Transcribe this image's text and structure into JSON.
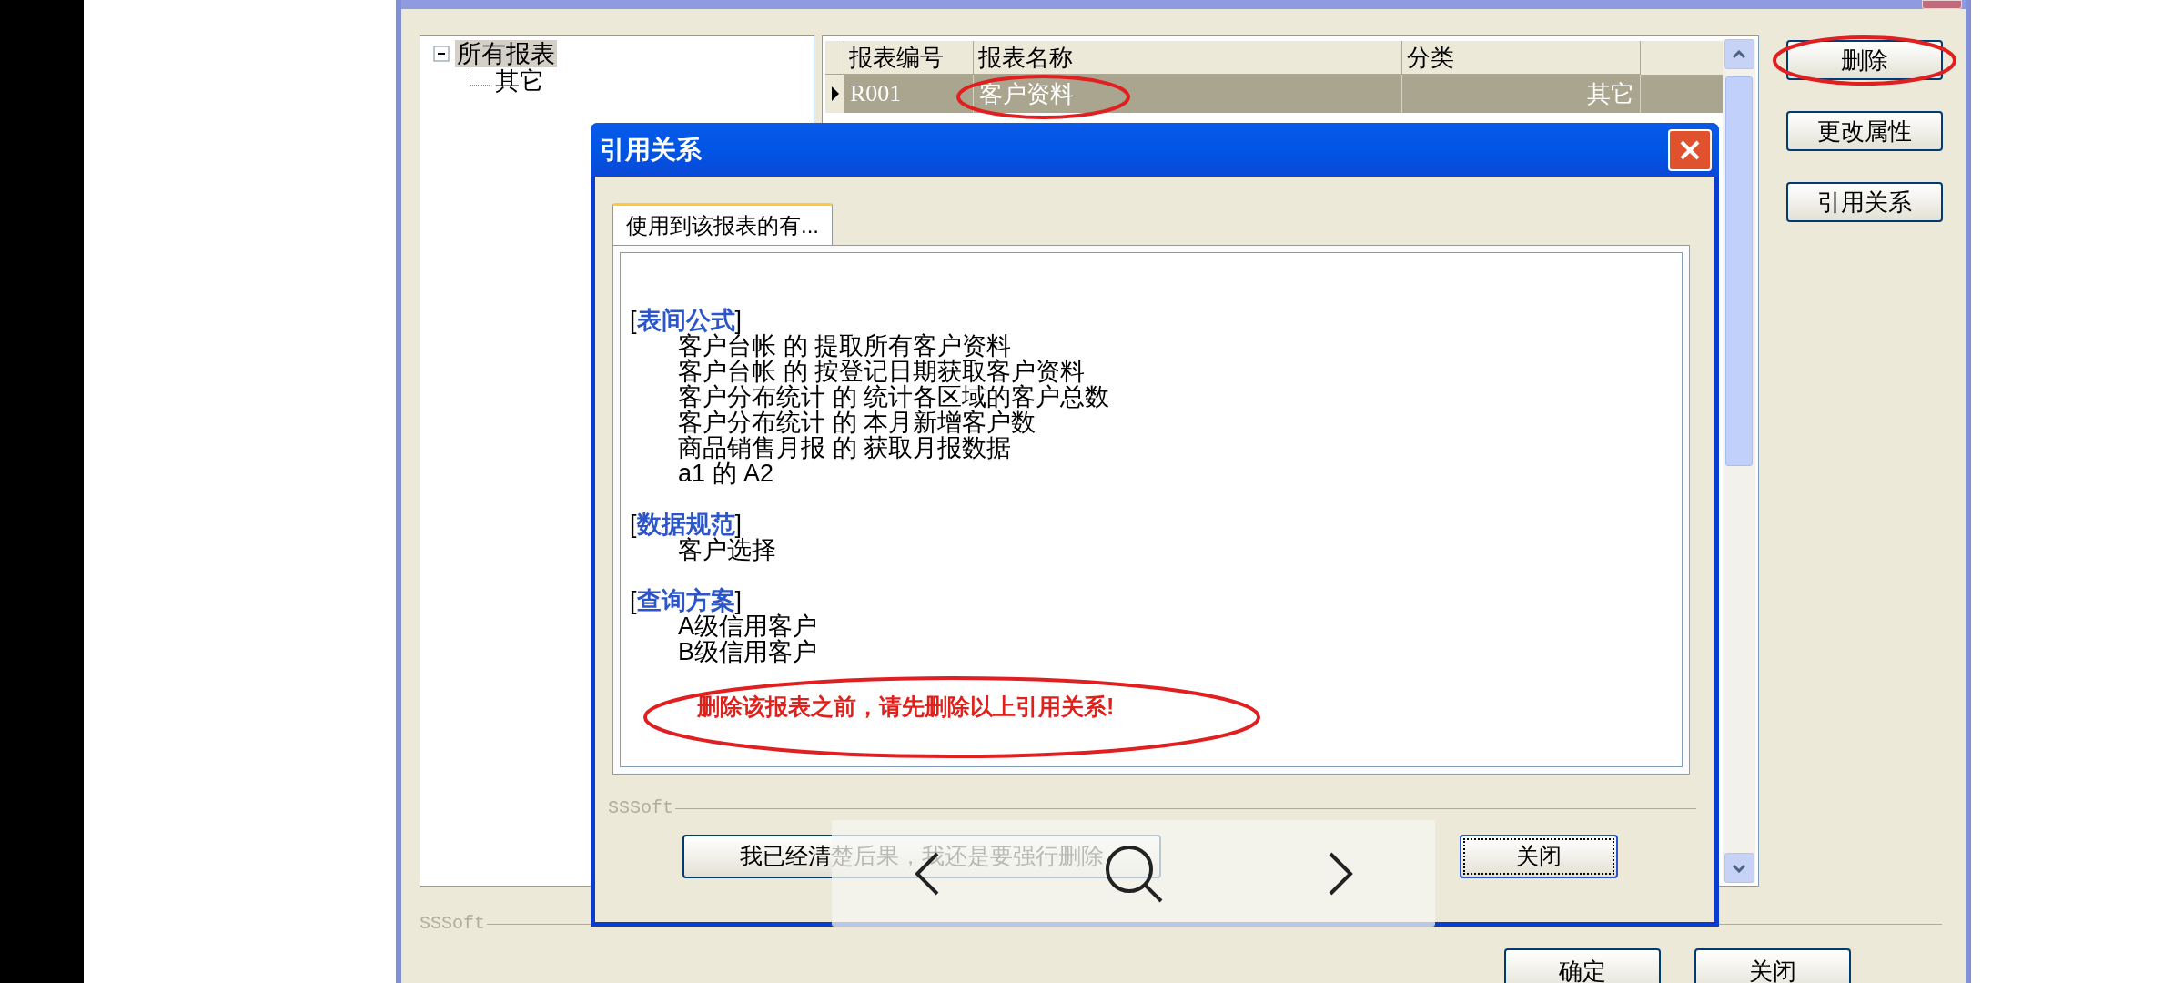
{
  "window": {
    "tree": [
      {
        "label": "所有报表",
        "expanded": true,
        "selected": true,
        "children": [
          {
            "label": "其它",
            "selected": false
          }
        ]
      }
    ],
    "table": {
      "columns": [
        "报表编号",
        "报表名称",
        "分类"
      ],
      "rows": [
        {
          "cells": [
            "R001",
            "客户资料",
            "其它"
          ],
          "selected": true
        }
      ]
    },
    "side_buttons": [
      "删除",
      "更改属性",
      "引用关系"
    ],
    "group_label": "SSSoft",
    "footer_buttons": [
      "确定",
      "关闭"
    ]
  },
  "dialog": {
    "title": "引用关系",
    "tabs": [
      {
        "label": "使用到该报表的有...",
        "selected": true
      }
    ],
    "sections": [
      {
        "open": "[",
        "heading": "表间公式",
        "close": "]",
        "items": [
          "客户台帐 的 提取所有客户资料",
          "客户台帐 的 按登记日期获取客户资料",
          "客户分布统计 的 统计各区域的客户总数",
          "客户分布统计 的 本月新增客户数",
          "商品销售月报 的 获取月报数据",
          "a1 的 A2"
        ]
      },
      {
        "open": "[",
        "heading": "数据规范",
        "close": "]",
        "items": [
          "客户选择"
        ]
      },
      {
        "open": "[",
        "heading": "查询方案",
        "close": "]",
        "items": [
          "A级信用客户",
          "B级信用客户"
        ]
      }
    ],
    "warning": "删除该报表之前，请先删除以上引用关系!",
    "group_label": "SSSoft",
    "buttons": [
      {
        "label": "我已经清楚后果，我还是要强行删除",
        "focused": false
      },
      {
        "label": "关闭",
        "focused": true
      }
    ]
  }
}
